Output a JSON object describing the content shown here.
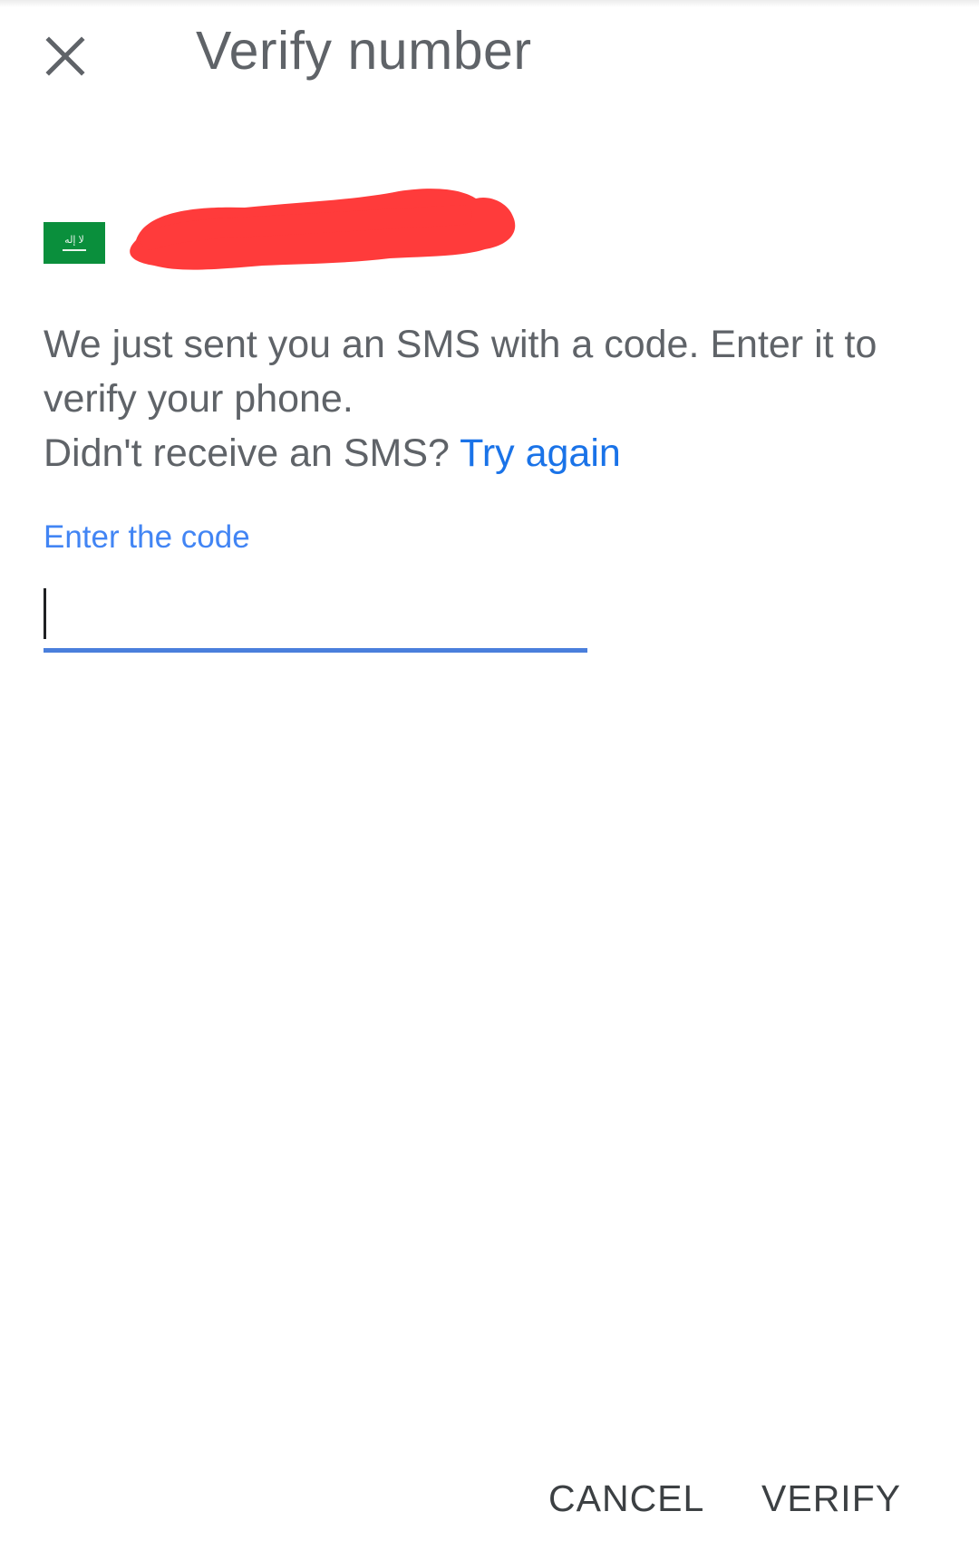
{
  "header": {
    "title": "Verify number",
    "close_icon": "close-icon"
  },
  "phone": {
    "country_flag": "saudi-arabia-flag-icon",
    "flag_script": "لا إله"
  },
  "message": {
    "line1": "We just sent you an SMS with a code. Enter it to verify your phone.",
    "line2_prefix": "Didn't receive an SMS? ",
    "try_again_label": "Try again"
  },
  "code_field": {
    "label": "Enter the code",
    "value": ""
  },
  "actions": {
    "cancel_label": "CANCEL",
    "verify_label": "VERIFY"
  },
  "colors": {
    "accent": "#4285f4",
    "link": "#1a73e8",
    "text": "#5f6368",
    "flag_green": "#0a8f3c",
    "redaction": "#ff3b3b"
  }
}
